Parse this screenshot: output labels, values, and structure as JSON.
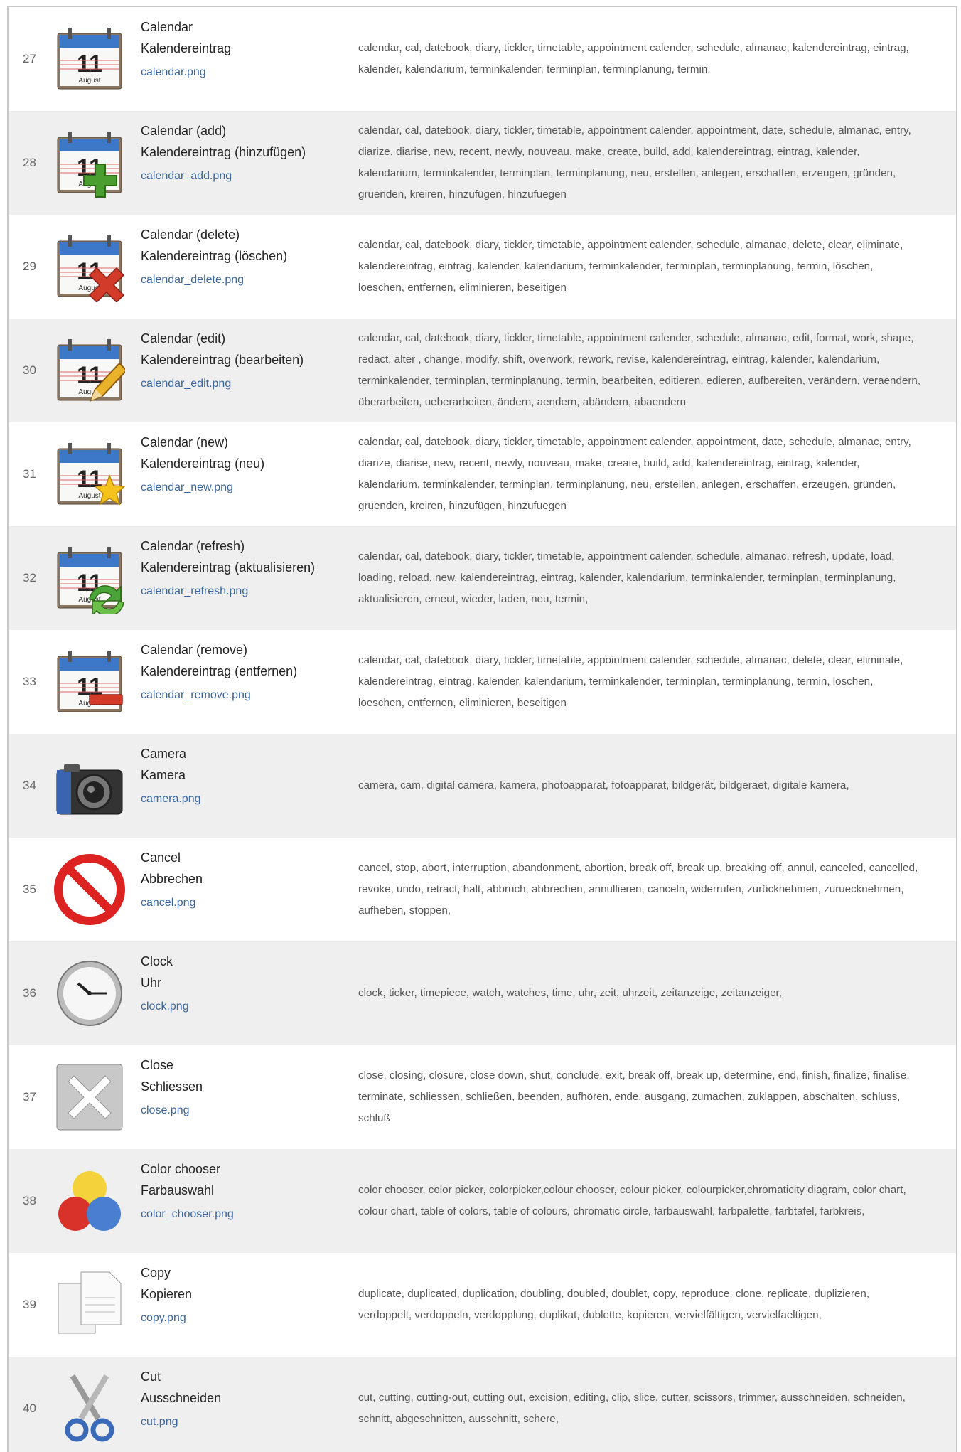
{
  "rows": [
    {
      "num": "27",
      "icon": "calendar-icon",
      "title": "Calendar",
      "title_de": "Kalendereintrag",
      "file": "calendar.png",
      "keywords": [
        "calendar, cal, datebook, diary, tickler, timetable, appointment calender, schedule, almanac, kalendereintrag, eintrag,",
        "kalender, kalendarium, terminkalender, terminplan, terminplanung, termin,"
      ]
    },
    {
      "num": "28",
      "icon": "calendar-add-icon",
      "title": "Calendar (add)",
      "title_de": "Kalendereintrag (hinzufügen)",
      "file": "calendar_add.png",
      "keywords": [
        "calendar, cal, datebook, diary, tickler, timetable, appointment calender, appointment, date, schedule, almanac, entry,",
        "diarize, diarise, new, recent, newly, nouveau, make, create, build, add, kalendereintrag, eintrag, kalender,",
        "kalendarium, terminkalender, terminplan, terminplanung, neu, erstellen, anlegen, erschaffen, erzeugen, gründen,",
        "gruenden, kreiren, hinzufügen, hinzufuegen"
      ]
    },
    {
      "num": "29",
      "icon": "calendar-delete-icon",
      "title": "Calendar (delete)",
      "title_de": "Kalendereintrag (löschen)",
      "file": "calendar_delete.png",
      "keywords": [
        "calendar, cal, datebook, diary, tickler, timetable, appointment calender, schedule, almanac, delete, clear, eliminate,",
        "kalendereintrag, eintrag, kalender, kalendarium, terminkalender, terminplan, terminplanung, termin, löschen,",
        "loeschen, entfernen, eliminieren, beseitigen"
      ]
    },
    {
      "num": "30",
      "icon": "calendar-edit-icon",
      "title": "Calendar (edit)",
      "title_de": "Kalendereintrag (bearbeiten)",
      "file": "calendar_edit.png",
      "keywords": [
        "calendar, cal, datebook, diary, tickler, timetable, appointment calender, schedule, almanac, edit, format, work, shape,",
        "redact, alter , change, modify, shift, overwork, rework, revise, kalendereintrag, eintrag, kalender, kalendarium,",
        "terminkalender, terminplan, terminplanung, termin, bearbeiten, editieren, edieren, aufbereiten, verändern, veraendern,",
        "überarbeiten, ueberarbeiten, ändern, aendern, abändern, abaendern"
      ]
    },
    {
      "num": "31",
      "icon": "calendar-new-icon",
      "title": "Calendar (new)",
      "title_de": "Kalendereintrag (neu)",
      "file": "calendar_new.png",
      "keywords": [
        "calendar, cal, datebook, diary, tickler, timetable, appointment calender, appointment, date, schedule, almanac, entry,",
        "diarize, diarise, new, recent, newly, nouveau, make, create, build, add, kalendereintrag, eintrag, kalender,",
        "kalendarium, terminkalender, terminplan, terminplanung, neu, erstellen, anlegen, erschaffen, erzeugen, gründen,",
        "gruenden, kreiren, hinzufügen, hinzufuegen"
      ]
    },
    {
      "num": "32",
      "icon": "calendar-refresh-icon",
      "title": "Calendar (refresh)",
      "title_de": "Kalendereintrag (aktualisieren)",
      "file": "calendar_refresh.png",
      "keywords": [
        "calendar, cal, datebook, diary, tickler, timetable, appointment calender, schedule, almanac, refresh, update, load,",
        "loading, reload, new, kalendereintrag, eintrag, kalender, kalendarium, terminkalender, terminplan, terminplanung,",
        "aktualisieren, erneut, wieder, laden, neu, termin,"
      ]
    },
    {
      "num": "33",
      "icon": "calendar-remove-icon",
      "title": "Calendar (remove)",
      "title_de": "Kalendereintrag (entfernen)",
      "file": "calendar_remove.png",
      "keywords": [
        "calendar, cal, datebook, diary, tickler, timetable, appointment calender, schedule, almanac, delete, clear, eliminate,",
        "kalendereintrag, eintrag, kalender, kalendarium, terminkalender, terminplan, terminplanung, termin, löschen,",
        "loeschen, entfernen, eliminieren, beseitigen"
      ]
    },
    {
      "num": "34",
      "icon": "camera-icon",
      "title": "Camera",
      "title_de": "Kamera",
      "file": "camera.png",
      "keywords": [
        "camera, cam, digital camera, kamera, photoapparat, fotoapparat, bildgerät, bildgeraet, digitale kamera,"
      ]
    },
    {
      "num": "35",
      "icon": "cancel-icon",
      "title": "Cancel",
      "title_de": "Abbrechen",
      "file": "cancel.png",
      "keywords": [
        "cancel, stop, abort, interruption, abandonment, abortion, break off, break up, breaking off, annul, canceled, cancelled,",
        "revoke, undo, retract, halt, abbruch, abbrechen, annullieren, canceln, widerrufen, zurücknehmen, zuruecknehmen,",
        "aufheben, stoppen,"
      ]
    },
    {
      "num": "36",
      "icon": "clock-icon",
      "title": "Clock",
      "title_de": "Uhr",
      "file": "clock.png",
      "keywords": [
        "clock, ticker, timepiece, watch, watches, time, uhr, zeit, uhrzeit, zeitanzeige, zeitanzeiger,"
      ]
    },
    {
      "num": "37",
      "icon": "close-icon",
      "title": "Close",
      "title_de": "Schliessen",
      "file": "close.png",
      "keywords": [
        "close, closing, closure, close down, shut, conclude, exit, break off, break up, determine, end, finish, finalize, finalise,",
        "terminate, schliessen, schließen, beenden, aufhören, ende, ausgang, zumachen, zuklappen, abschalten, schluss,",
        "schluß"
      ]
    },
    {
      "num": "38",
      "icon": "color-chooser-icon",
      "title": "Color chooser",
      "title_de": "Farbauswahl",
      "file": "color_chooser.png",
      "keywords": [
        "color chooser, color picker, colorpicker,colour chooser, colour picker, colourpicker,chromaticity diagram, color chart,",
        "colour chart, table of colors, table of colours, chromatic circle, farbauswahl, farbpalette, farbtafel, farbkreis,"
      ]
    },
    {
      "num": "39",
      "icon": "copy-icon",
      "title": "Copy",
      "title_de": "Kopieren",
      "file": "copy.png",
      "keywords": [
        "duplicate, duplicated, duplication, doubling, doubled, doublet, copy, reproduce, clone, replicate, duplizieren,",
        "verdoppelt, verdoppeln, verdopplung, duplikat, dublette, kopieren, vervielfältigen, vervielfaeltigen,"
      ]
    },
    {
      "num": "40",
      "icon": "scissors-icon",
      "title": "Cut",
      "title_de": "Ausschneiden",
      "file": "cut.png",
      "keywords": [
        "cut, cutting, cutting-out, cutting out, excision, editing, clip, slice, cutter, scissors, trimmer, ausschneiden, schneiden,",
        "schnitt, abgeschnitten, ausschnitt, schere,"
      ]
    }
  ]
}
